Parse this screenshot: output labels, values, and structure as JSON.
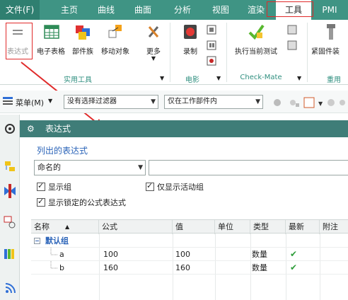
{
  "tabs": [
    {
      "label": "文件(F)"
    },
    {
      "label": "主页"
    },
    {
      "label": "曲线"
    },
    {
      "label": "曲面"
    },
    {
      "label": "分析"
    },
    {
      "label": "视图"
    },
    {
      "label": "渲染"
    },
    {
      "label": "工具"
    },
    {
      "label": "PMI"
    }
  ],
  "ribbon": {
    "buttons": {
      "expression": "表达式",
      "spreadsheet": "电子表格",
      "part_family": "部件族",
      "move_object": "移动对象",
      "more": "更多",
      "record": "录制",
      "run_check": "执行当前测试",
      "fastener": "紧固件装"
    },
    "groups": {
      "utility": "实用工具",
      "movie": "电影",
      "checkmate": "Check-Mate",
      "reuse": "重用"
    }
  },
  "filterbar": {
    "menu_label": "菜单(M)",
    "filter_value": "没有选择过滤器",
    "scope_value": "仅在工作部件内"
  },
  "panel": {
    "title": "表达式",
    "section_title": "列出的表达式",
    "list_select": "命名的",
    "checkboxes": {
      "show_groups": "显示组",
      "active_only": "仅显示活动组",
      "show_locked": "显示锁定的公式表达式"
    },
    "table": {
      "headers": [
        "名称",
        "公式",
        "值",
        "单位",
        "类型",
        "最新",
        "附注"
      ],
      "group_name": "默认组",
      "rows": [
        {
          "name": "a",
          "formula": "100",
          "value": "100",
          "type": "数量"
        },
        {
          "name": "b",
          "formula": "160",
          "value": "160",
          "type": "数量"
        }
      ]
    }
  },
  "colors": {
    "accent": "#3f9484",
    "panel_header": "#3f7d78",
    "highlight": "#e02a2a"
  }
}
